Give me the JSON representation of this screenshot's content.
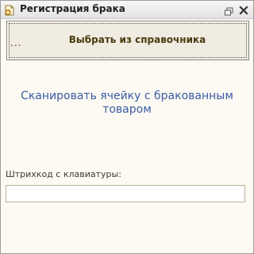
{
  "window": {
    "title": "Регистрация брака",
    "icons": {
      "app": "document-plus-icon",
      "restore": "restore-window-icon",
      "close": "close-icon"
    }
  },
  "select_button": {
    "dots": "...",
    "label": "Выбрать из справочника"
  },
  "scan_label": "Сканировать ячейку с бракованным товаром",
  "barcode": {
    "caption": "Штрихкод с клавиатуры:",
    "value": ""
  },
  "colors": {
    "background": "#fcfaf2",
    "button_bg": "#f1ece2",
    "button_text": "#4a3a10",
    "scan_text": "#3b5aa5"
  }
}
